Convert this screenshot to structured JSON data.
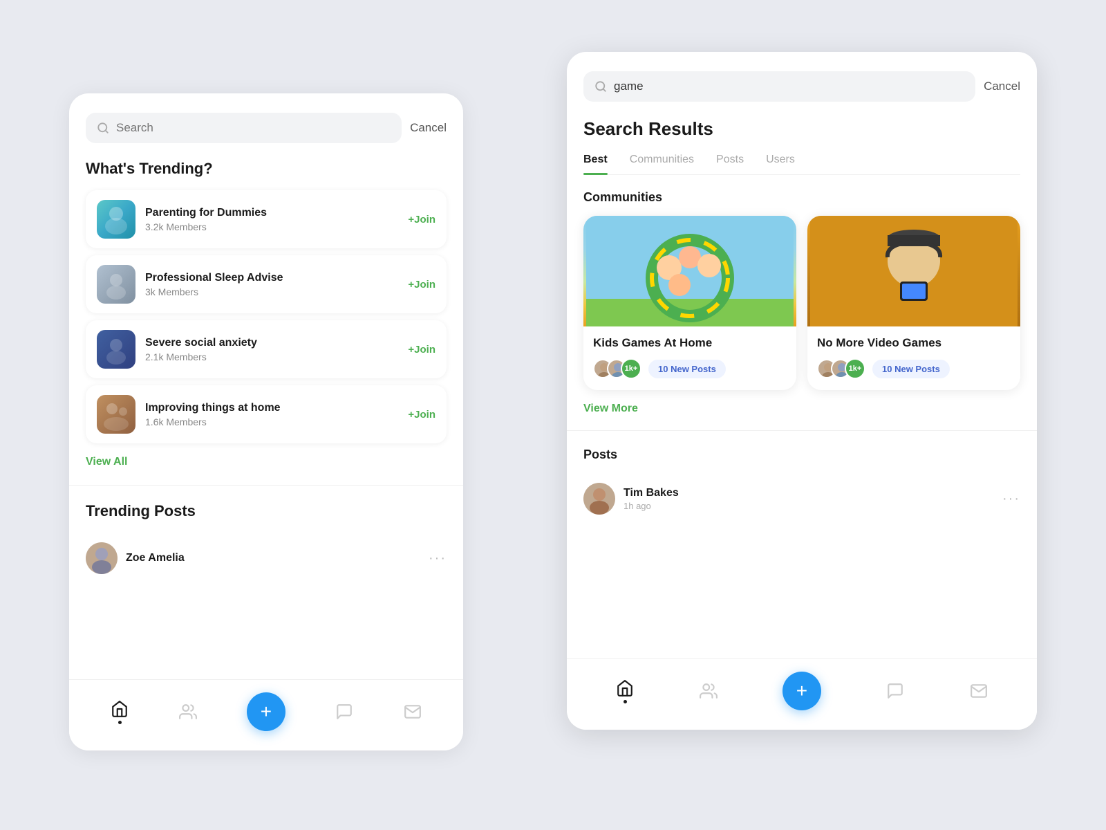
{
  "left_panel": {
    "search": {
      "placeholder": "Search",
      "cancel_label": "Cancel"
    },
    "trending_section": {
      "title": "What's Trending?",
      "items": [
        {
          "name": "Parenting for Dummies",
          "members": "3.2k Members",
          "join_label": "+Join"
        },
        {
          "name": "Professional Sleep Advise",
          "members": "3k Members",
          "join_label": "+Join"
        },
        {
          "name": "Severe social anxiety",
          "members": "2.1k Members",
          "join_label": "+Join"
        },
        {
          "name": "Improving things at home",
          "members": "1.6k Members",
          "join_label": "+Join"
        }
      ],
      "view_all": "View All"
    },
    "trending_posts": {
      "title": "Trending Posts",
      "items": [
        {
          "author": "Zoe Amelia"
        }
      ]
    },
    "nav": {
      "home": "home",
      "groups": "groups",
      "add": "+",
      "chat": "chat",
      "mail": "mail"
    }
  },
  "right_panel": {
    "search": {
      "value": "game",
      "cancel_label": "Cancel"
    },
    "results_title": "Search Results",
    "tabs": [
      {
        "label": "Best",
        "active": true
      },
      {
        "label": "Communities",
        "active": false
      },
      {
        "label": "Posts",
        "active": false
      },
      {
        "label": "Users",
        "active": false
      }
    ],
    "communities_section": {
      "title": "Communities",
      "cards": [
        {
          "name": "Kids Games At Home",
          "members_badge": "1k+",
          "new_posts": "10 New Posts"
        },
        {
          "name": "No More Video Games",
          "members_badge": "1k+",
          "new_posts": "10 New Posts"
        }
      ],
      "view_more": "View More"
    },
    "posts_section": {
      "title": "Posts",
      "items": [
        {
          "author": "Tim Bakes",
          "time": "1h ago"
        }
      ]
    },
    "nav": {
      "home": "home",
      "groups": "groups",
      "add": "+",
      "chat": "chat",
      "mail": "mail"
    }
  }
}
